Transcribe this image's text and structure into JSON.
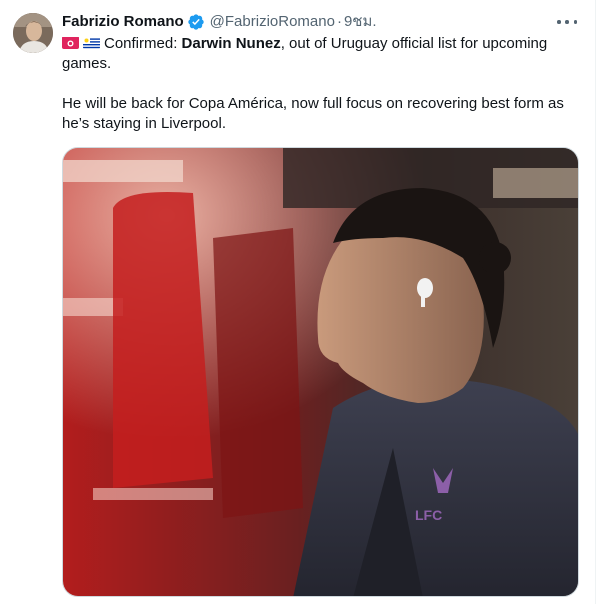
{
  "tweet": {
    "author_name": "Fabrizio Romano",
    "author_handle": "@FabrizioRomano",
    "separator": "·",
    "timestamp": "9ชม.",
    "flags": [
      "sun-flag-icon",
      "uruguay-flag-icon"
    ],
    "line1": {
      "prefix": "Confirmed: ",
      "name": "Darwin Nunez",
      "suffix": ", out of Uruguay official list for upcoming games."
    },
    "line2": "He will be back for Copa América, now full focus on recovering best form as he’s staying in Liverpool.",
    "image": {
      "jacket_logo": "LFC"
    }
  },
  "colors": {
    "verified_blue": "#1d9bf0",
    "secondary_text": "#536471",
    "primary_text": "#0f1419"
  }
}
